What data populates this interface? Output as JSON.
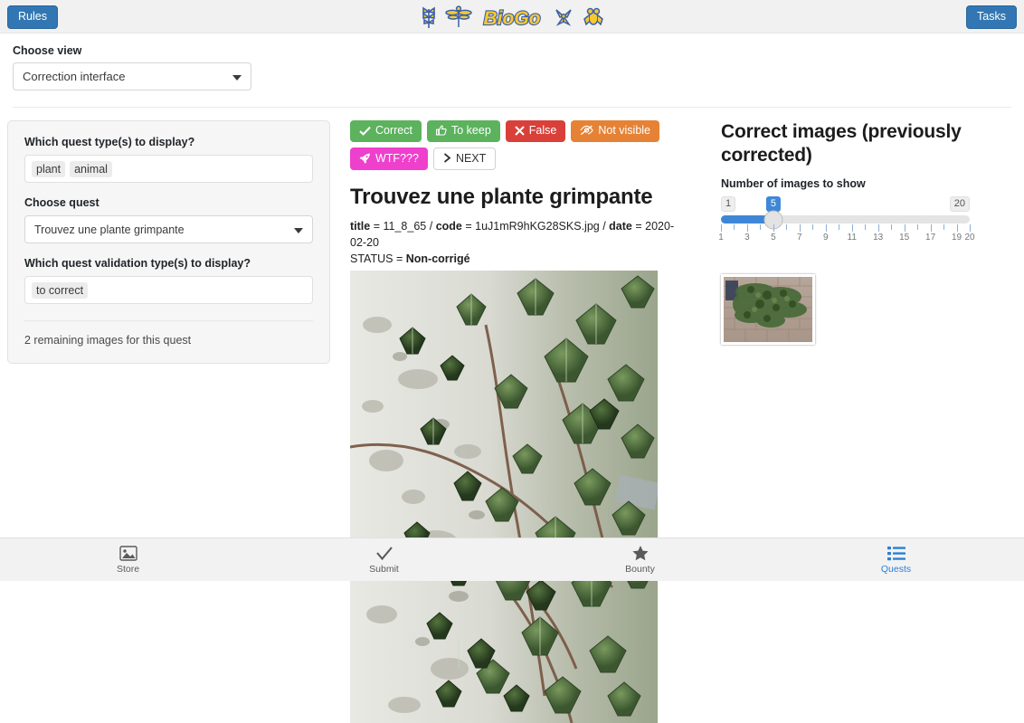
{
  "header": {
    "rules_label": "Rules",
    "tasks_label": "Tasks",
    "logo_text": "BioGo",
    "logo_icons": [
      "plant-icon",
      "dragonfly-icon",
      "biogo-logo",
      "flower-icon",
      "frog-icon"
    ],
    "logo_yellow": "#f5c935",
    "logo_blue": "#3a5fa8",
    "button_blue": "#3277b3"
  },
  "view": {
    "label": "Choose view",
    "selected": "Correction interface"
  },
  "filters": {
    "quest_type_label": "Which quest type(s) to display?",
    "quest_type_chips": [
      "plant",
      "animal"
    ],
    "choose_quest_label": "Choose quest",
    "choose_quest_value": "Trouvez une plante grimpante",
    "validation_label": "Which quest validation type(s) to display?",
    "validation_chips": [
      "to correct"
    ],
    "remaining": "2 remaining images for this quest"
  },
  "actions": [
    {
      "label": "Correct",
      "icon": "check-icon",
      "color": "#5cb25d",
      "text_color": "#ffffff",
      "name": "correct-button"
    },
    {
      "label": "To keep",
      "icon": "thumbs-up-icon",
      "color": "#5cb25d",
      "text_color": "#ffffff",
      "name": "to-keep-button"
    },
    {
      "label": "False",
      "icon": "cross-icon",
      "color": "#d9403a",
      "text_color": "#ffffff",
      "name": "false-button"
    },
    {
      "label": "Not visible",
      "icon": "eye-slash-icon",
      "color": "#e58235",
      "text_color": "#ffffff",
      "name": "not-visible-button"
    },
    {
      "label": "WTF???",
      "icon": "rocket-icon",
      "color": "#ee40cc",
      "text_color": "#ffffff",
      "name": "wtf-button"
    },
    {
      "label": "NEXT",
      "icon": "chevron-right-icon",
      "color": "#ffffff",
      "text_color": "#333333",
      "name": "next-button"
    }
  ],
  "quest": {
    "title": "Trouvez une plante grimpante",
    "meta_title_key": "title",
    "meta_title_value": "11_8_65",
    "meta_code_key": "code",
    "meta_code_value": "1uJ1mR9hKG28SKS.jpg",
    "meta_date_key": "date",
    "meta_date_value": "2020-02-20",
    "status_key": "STATUS",
    "status_value": "Non-corrigé",
    "photo_alt": "ivy-on-wall-photo"
  },
  "right": {
    "title": "Correct images (previously corrected)",
    "slider_label": "Number of images to show",
    "slider": {
      "min": 1,
      "max": 20,
      "value": 5,
      "min_label": "1",
      "max_label": "20",
      "value_label": "5",
      "tick_labels": [
        "1",
        "3",
        "5",
        "7",
        "9",
        "11",
        "13",
        "15",
        "17",
        "19",
        "20"
      ]
    },
    "thumbnail_alt": "corrected-image-thumbnail"
  },
  "footer": [
    {
      "label": "Store",
      "icon": "image-icon",
      "active": false,
      "name": "nav-store"
    },
    {
      "label": "Submit",
      "icon": "check-icon",
      "active": false,
      "name": "nav-submit"
    },
    {
      "label": "Bounty",
      "icon": "star-icon",
      "active": false,
      "name": "nav-bounty"
    },
    {
      "label": "Quests",
      "icon": "list-icon",
      "active": true,
      "name": "nav-quests"
    }
  ]
}
